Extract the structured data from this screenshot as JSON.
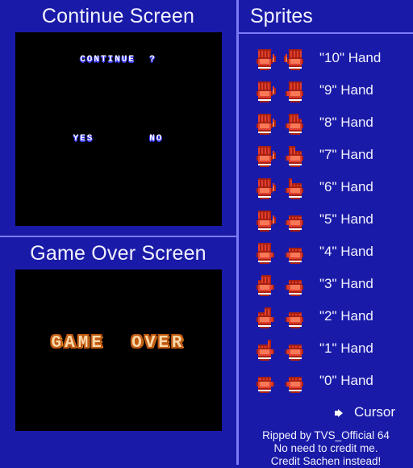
{
  "theme": {
    "background": "#1A1AA8",
    "divider": "#7B7BF5",
    "screen_bg": "#000000",
    "title_color": "#F2F2FF",
    "hand_light": "#F87858",
    "hand_mid": "#E04030",
    "hand_dark": "#A82010",
    "hand_white": "#FCFCFC",
    "continue_text": "#FCFCFC",
    "continue_shadow": "#3838F0",
    "gameover_fill": "#F8D8A8",
    "gameover_outline": "#C05810",
    "cursor_color": "#FCFCFC"
  },
  "panels": {
    "continue": {
      "title": "Continue Screen",
      "prompt": "CONTINUE  ?",
      "option_yes": "YES",
      "option_no": "NO"
    },
    "game_over": {
      "title": "Game Over Screen",
      "text": "GAME  OVER"
    }
  },
  "sprites": {
    "title": "Sprites",
    "rows": [
      {
        "label": "\"10\" Hand",
        "left_fingers": 5,
        "right_fingers": 5
      },
      {
        "label": "\"9\" Hand",
        "left_fingers": 5,
        "right_fingers": 4
      },
      {
        "label": "\"8\" Hand",
        "left_fingers": 5,
        "right_fingers": 3
      },
      {
        "label": "\"7\" Hand",
        "left_fingers": 5,
        "right_fingers": 2
      },
      {
        "label": "\"6\" Hand",
        "left_fingers": 5,
        "right_fingers": 1
      },
      {
        "label": "\"5\" Hand",
        "left_fingers": 5,
        "right_fingers": 0
      },
      {
        "label": "\"4\" Hand",
        "left_fingers": 4,
        "right_fingers": 0
      },
      {
        "label": "\"3\" Hand",
        "left_fingers": 3,
        "right_fingers": 0
      },
      {
        "label": "\"2\" Hand",
        "left_fingers": 2,
        "right_fingers": 0
      },
      {
        "label": "\"1\" Hand",
        "left_fingers": 1,
        "right_fingers": 0
      },
      {
        "label": "\"0\" Hand",
        "left_fingers": 0,
        "right_fingers": 0
      }
    ],
    "cursor": {
      "label": "Cursor",
      "icon": "cursor-arrow-icon"
    }
  },
  "credits": {
    "line1": "Ripped by TVS_Official 64",
    "line2": "No need to credit me.",
    "line3": "Credit Sachen instead!"
  }
}
